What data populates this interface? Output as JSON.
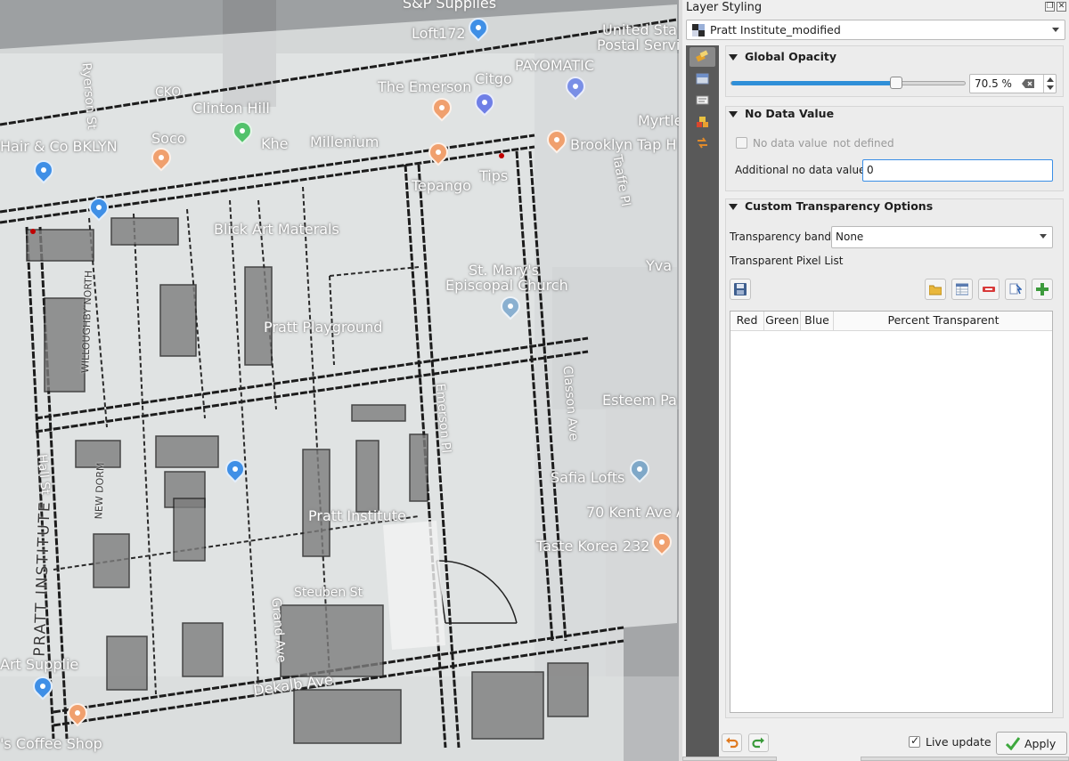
{
  "map": {
    "labels": [
      "S&P Supplies",
      "Loft172",
      "United Sta",
      "Postal Servi",
      "PAYOMATIC",
      "CKO",
      "The Emerson",
      "Citgo",
      "Myrtle",
      "Clinton Hill",
      "Hair & Co BKLYN",
      "Soco",
      "Khe",
      "Millenium",
      "Brooklyn Tap H",
      "Tips",
      "Tepango",
      "Blick Art Materals",
      "St. Mary's",
      "Episcopal Church",
      "Pratt Playground",
      "Esteem Pa",
      "Pratt Institute",
      "Safia Lofts",
      "70 Kent Ave A",
      "Taste Korea 232",
      "Steuben St",
      "Dekalb Ave",
      "Art Supplie",
      "'s Coffee Shop",
      "Yva",
      "Taaffe Pl",
      "Ryerson St",
      "Hall St",
      "Emerson Pl",
      "Classon Ave",
      "Grand Ave",
      "WILLOUGHBY NORTH",
      "PRATT INSTITUTE",
      "NEW DORM"
    ]
  },
  "panel": {
    "title": "Layer Styling",
    "float_icon": "float-icon",
    "close_icon": "close-icon",
    "layer": "Pratt Institute_modified",
    "tools": [
      "symbology-icon",
      "transparency-icon",
      "labels-icon",
      "rendering-icon",
      "history-icon"
    ],
    "global_opacity": {
      "title": "Global Opacity",
      "value": 70.5,
      "display": "70.5 %"
    },
    "no_data": {
      "title": "No Data Value",
      "checkbox_label": "No data value",
      "checkbox_value": "not defined",
      "additional_label": "Additional no data value",
      "additional_value": "0"
    },
    "custom_transparency": {
      "title": "Custom Transparency Options",
      "band_label": "Transparency band",
      "band_value": "None",
      "pixel_list_label": "Transparent Pixel List",
      "table_headers": [
        "Red",
        "Green",
        "Blue",
        "Percent Transparent"
      ],
      "rows": []
    },
    "footer": {
      "live_update_label": "Live update",
      "live_update_checked": true,
      "apply_label": "Apply"
    }
  }
}
